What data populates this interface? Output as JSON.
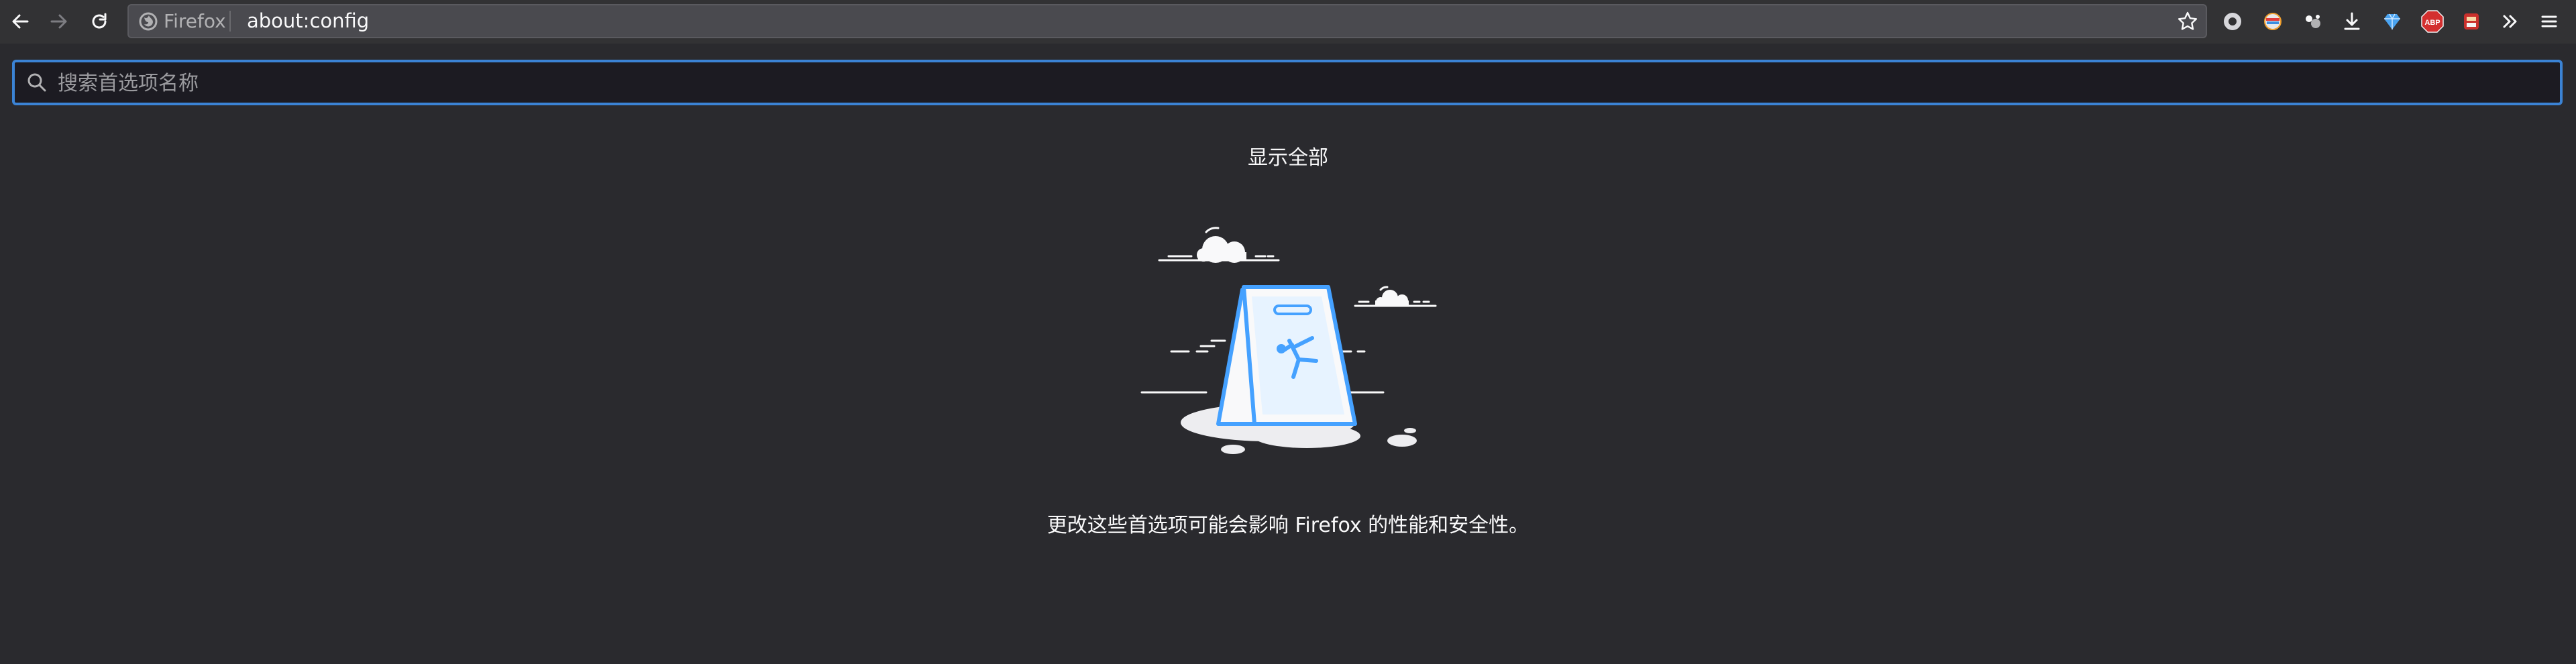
{
  "toolbar": {
    "back_icon": "arrow-left-icon",
    "forward_icon": "arrow-right-icon",
    "reload_icon": "reload-icon",
    "identity_label": "Firefox",
    "url": "about:config",
    "bookmark_icon": "star-icon",
    "extensions": [
      "circle-extension-icon",
      "colorful-ring-extension-icon",
      "dots-extension-icon",
      "download-icon",
      "diamond-extension-icon",
      "abp-extension-icon",
      "stamp-extension-icon",
      "overflow-chevron-icon",
      "menu-icon"
    ],
    "abp_label": "ABP"
  },
  "search": {
    "placeholder": "搜索首选项名称",
    "value": ""
  },
  "main": {
    "show_all_label": "显示全部",
    "warning_text": "更改这些首选项可能会影响 Firefox 的性能和安全性。"
  },
  "colors": {
    "background": "#2a2a2e",
    "toolbar": "#323234",
    "focus_ring": "#3b83d5",
    "sign_blue": "#45a1ff"
  }
}
